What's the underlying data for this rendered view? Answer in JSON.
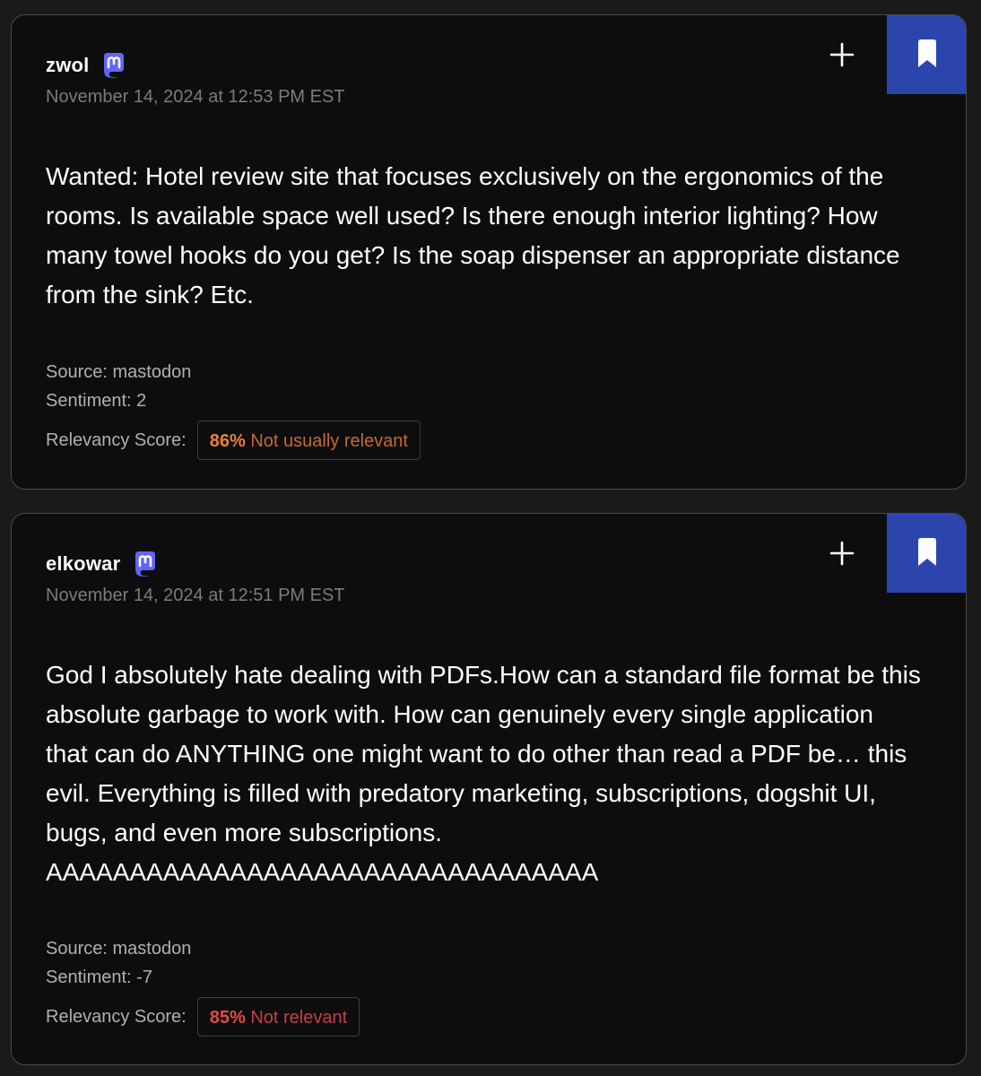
{
  "colors": {
    "background": "#1a1a1a",
    "card": "#0d0d0d",
    "bookmark": "#2b45ad",
    "mastodon": "#6364ff",
    "orange": "#e8803f",
    "red": "#e14b4b"
  },
  "posts": [
    {
      "username": "zwol",
      "platform_icon": "mastodon-icon",
      "timestamp": "November 14, 2024 at 12:53 PM EST",
      "text": "Wanted: Hotel review site that focuses exclusively on the ergonomics of the rooms. Is available space well used? Is there enough interior lighting? How many towel hooks do you get? Is the soap dispenser an appropriate distance from the sink? Etc.",
      "source": "Source: mastodon",
      "sentiment": "Sentiment: 2",
      "relevancy_label": "Relevancy Score:",
      "relevancy_pct": "86%",
      "relevancy_text": "Not usually relevant"
    },
    {
      "username": "elkowar",
      "platform_icon": "mastodon-icon",
      "timestamp": "November 14, 2024 at 12:51 PM EST",
      "text": "God I absolutely hate dealing with PDFs.How can a standard file format be this absolute garbage to work with. How can genuinely every single application that can do ANYTHING one might want to do other than read a PDF be… this evil. Everything is filled with predatory marketing, subscriptions, dogshit UI, bugs, and even more subscriptions. AAAAAAAAAAAAAAAAAAAAAAAAAAAAAAAAA",
      "source": "Source: mastodon",
      "sentiment": "Sentiment: -7",
      "relevancy_label": "Relevancy Score:",
      "relevancy_pct": "85%",
      "relevancy_text": "Not relevant"
    }
  ]
}
